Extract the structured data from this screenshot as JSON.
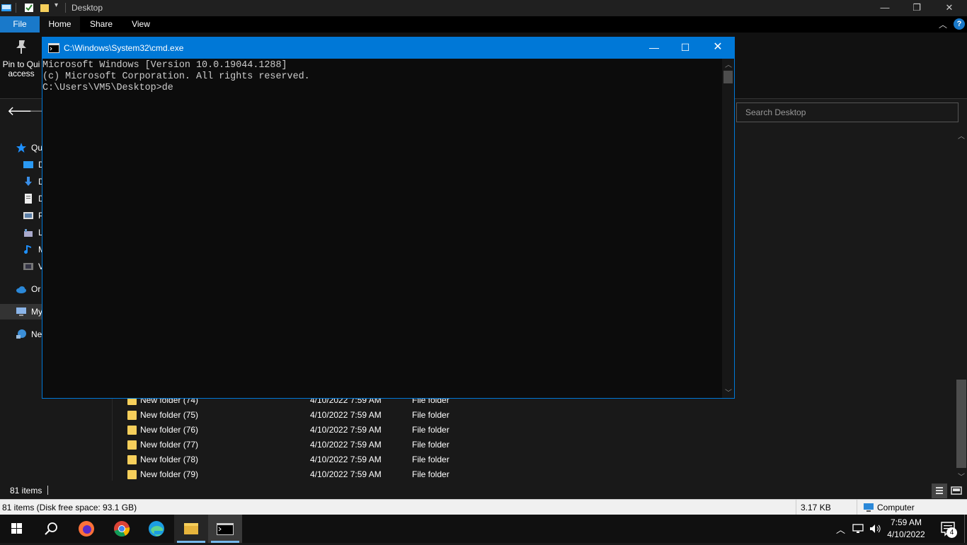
{
  "explorer": {
    "title": "Desktop",
    "tabs": [
      "File",
      "Home",
      "Share",
      "View"
    ],
    "ribbon": {
      "pin_label_line1": "Pin to Qui",
      "pin_label_line2": "access"
    },
    "search_placeholder": "Search Desktop",
    "sidebar": [
      {
        "label": "Qu",
        "icon": "star-icon"
      },
      {
        "label": "D",
        "icon": "desktop-icon"
      },
      {
        "label": "D",
        "icon": "downloads-icon"
      },
      {
        "label": "D",
        "icon": "documents-icon"
      },
      {
        "label": "P",
        "icon": "pictures-icon"
      },
      {
        "label": "L",
        "icon": "libraries-icon"
      },
      {
        "label": "M",
        "icon": "music-icon"
      },
      {
        "label": "V",
        "icon": "videos-icon"
      },
      {
        "label": "Or",
        "icon": "onedrive-icon"
      },
      {
        "label": "My",
        "icon": "computer-icon"
      },
      {
        "label": "Ne",
        "icon": "network-icon"
      }
    ],
    "rows": [
      {
        "name": "New folder (74)",
        "date": "4/10/2022 7:59 AM",
        "type": "File folder"
      },
      {
        "name": "New folder (75)",
        "date": "4/10/2022 7:59 AM",
        "type": "File folder"
      },
      {
        "name": "New folder (76)",
        "date": "4/10/2022 7:59 AM",
        "type": "File folder"
      },
      {
        "name": "New folder (77)",
        "date": "4/10/2022 7:59 AM",
        "type": "File folder"
      },
      {
        "name": "New folder (78)",
        "date": "4/10/2022 7:59 AM",
        "type": "File folder"
      },
      {
        "name": "New folder (79)",
        "date": "4/10/2022 7:59 AM",
        "type": "File folder"
      }
    ],
    "status_items": "81 items",
    "details_left": "81 items (Disk free space: 93.1 GB)",
    "details_size": "3.17 KB",
    "details_location": "Computer"
  },
  "cmd": {
    "title": "C:\\Windows\\System32\\cmd.exe",
    "lines": [
      "Microsoft Windows [Version 10.0.19044.1288]",
      "(c) Microsoft Corporation. All rights reserved.",
      "",
      "C:\\Users\\VM5\\Desktop>de"
    ]
  },
  "taskbar": {
    "time": "7:59 AM",
    "date": "4/10/2022",
    "notification_count": "4"
  },
  "colors": {
    "accent": "#0078d7",
    "folder": "#f6cf5b"
  }
}
